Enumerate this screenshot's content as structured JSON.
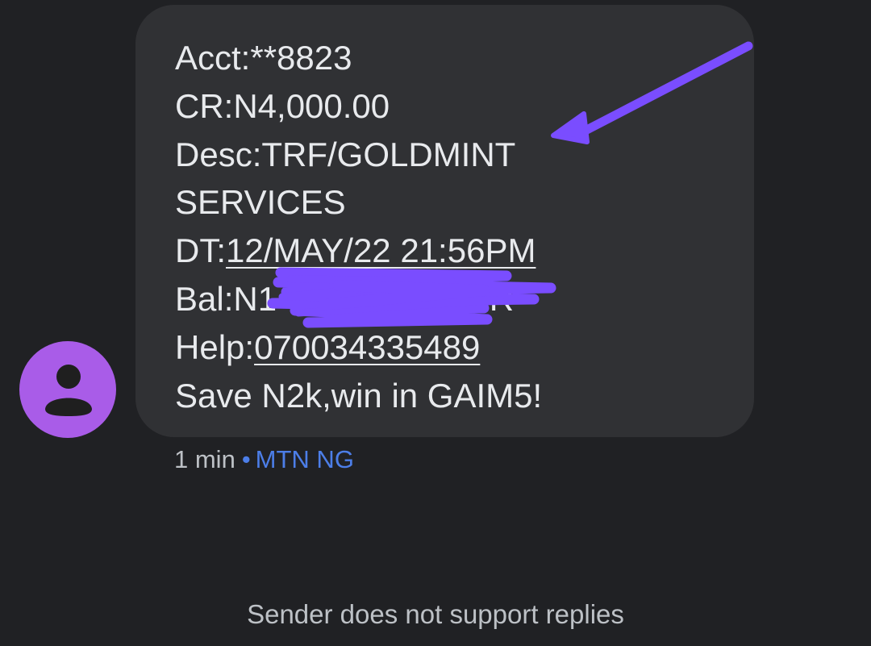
{
  "message": {
    "lines": [
      {
        "text": "Acct:**8823"
      },
      {
        "text": "CR:N4,000.00"
      },
      {
        "text": "Desc:TRF/GOLDMINT"
      },
      {
        "text": "SERVICES"
      },
      {
        "prefix": "DT:",
        "link": "12/MAY/22 21:56PM"
      },
      {
        "prefix": "Bal:N1",
        "link": "",
        "suffix": "0CR"
      },
      {
        "prefix": "Help:",
        "link": "070034335489"
      },
      {
        "text": "Save N2k,win in GAIM5!"
      }
    ]
  },
  "meta": {
    "time": "1 min",
    "separator": "•",
    "sender": "MTN NG"
  },
  "footer": {
    "note": "Sender does not support replies"
  },
  "icons": {
    "avatar": "person-icon",
    "annotation_arrow": "arrow-annotation",
    "redaction": "scribble-redaction"
  },
  "colors": {
    "background": "#202124",
    "bubble": "#303134",
    "avatar": "#a95ce8",
    "link_accent": "#4c7ee8",
    "annotation": "#7a4dff"
  }
}
